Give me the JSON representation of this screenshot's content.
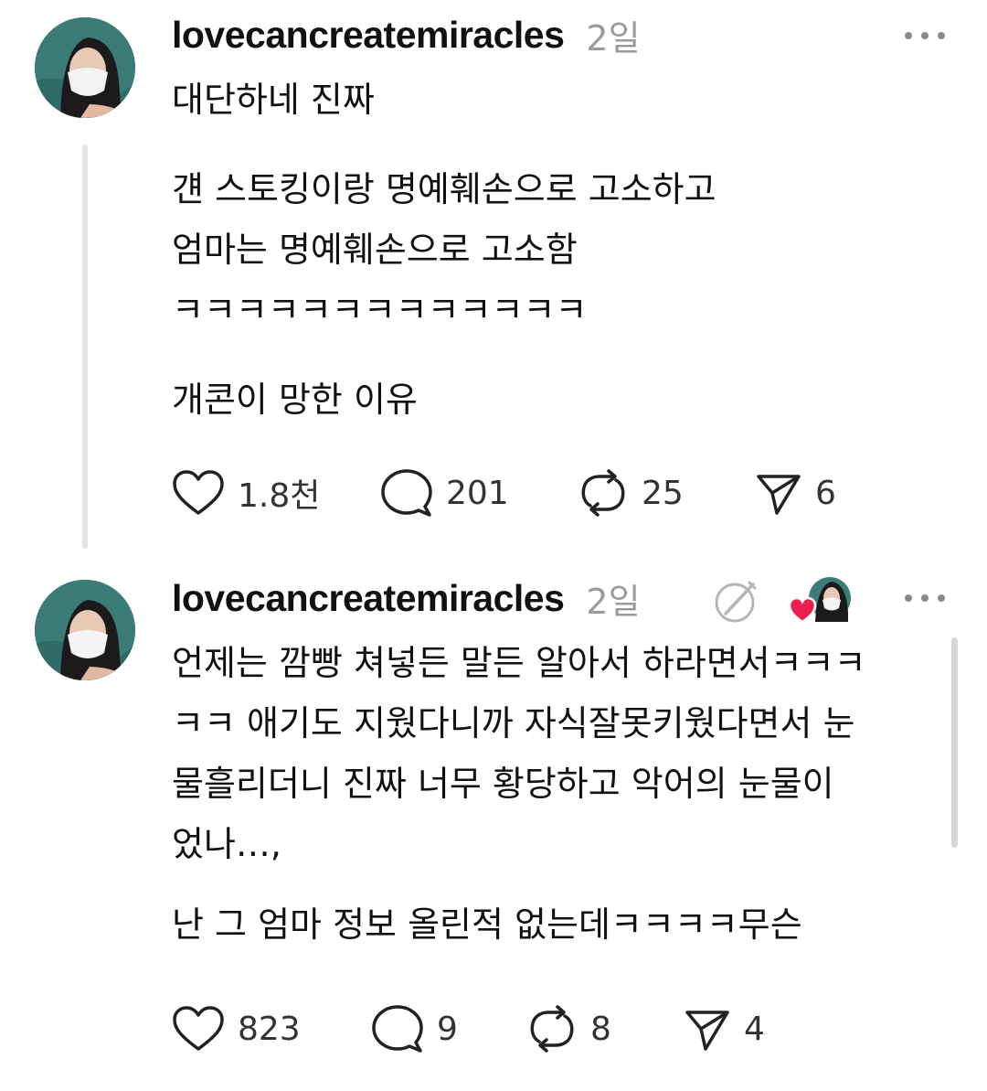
{
  "posts": [
    {
      "username": "lovecancreatemiracles",
      "time": "2일",
      "lines": [
        "대단하네 진짜",
        "",
        "걘 스토킹이랑 명예훼손으로 고소하고",
        "엄마는 명예훼손으로 고소함",
        "ㅋㅋㅋㅋㅋㅋㅋㅋㅋㅋㅋㅋㅋ",
        "",
        "개콘이 망한 이유"
      ],
      "stats": {
        "likes": "1.8천",
        "replies": "201",
        "reposts": "25",
        "shares": "6"
      }
    },
    {
      "username": "lovecancreatemiracles",
      "time": "2일",
      "lines": [
        "언제는 깜빵 쳐넣든 말든 알아서 하라면서ㅋㅋㅋ",
        "ㅋㅋ 애기도 지웠다니까 자식잘못키웠다면서 눈",
        "물흘리더니 진짜 너무 황당하고 악어의 눈물이",
        "었나…,",
        "",
        "난 그 엄마 정보 올린적 없는데ㅋㅋㅋㅋ무슨"
      ],
      "stats": {
        "likes": "823",
        "replies": "9",
        "reposts": "8",
        "shares": "4"
      }
    }
  ],
  "icons": {
    "like": "heart-icon",
    "reply": "comment-icon",
    "repost": "repost-icon",
    "share": "send-icon",
    "more": "more-dots-icon",
    "edited": "edited-icon",
    "liked_by_author": "heart-badge-icon"
  },
  "colors": {
    "heart_badge": "#ee1d52",
    "text": "#111111",
    "muted": "#9b9b9b"
  }
}
